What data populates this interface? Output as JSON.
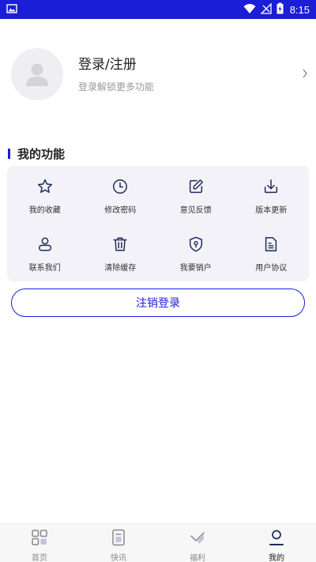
{
  "status_bar": {
    "time": "8:15"
  },
  "profile": {
    "title": "登录/注册",
    "subtitle": "登录解锁更多功能"
  },
  "section": {
    "title": "我的功能"
  },
  "functions": [
    {
      "label": "我的收藏",
      "icon": "star-icon"
    },
    {
      "label": "修改密码",
      "icon": "clock-icon"
    },
    {
      "label": "意见反馈",
      "icon": "edit-icon"
    },
    {
      "label": "版本更新",
      "icon": "download-icon"
    },
    {
      "label": "联系我们",
      "icon": "contact-icon"
    },
    {
      "label": "清除缓存",
      "icon": "trash-icon"
    },
    {
      "label": "我要销户",
      "icon": "shield-icon"
    },
    {
      "label": "用户协议",
      "icon": "document-icon"
    }
  ],
  "logout": {
    "label": "注销登录"
  },
  "tabs": [
    {
      "label": "首页",
      "icon": "grid-icon",
      "active": false
    },
    {
      "label": "快讯",
      "icon": "news-icon",
      "active": false
    },
    {
      "label": "福利",
      "icon": "gift-icon",
      "active": false
    },
    {
      "label": "我的",
      "icon": "user-icon",
      "active": true
    }
  ],
  "colors": {
    "accent": "#1a1ed6",
    "card_bg": "#f2f2f8",
    "tabbar_bg": "#f7f7f7"
  }
}
